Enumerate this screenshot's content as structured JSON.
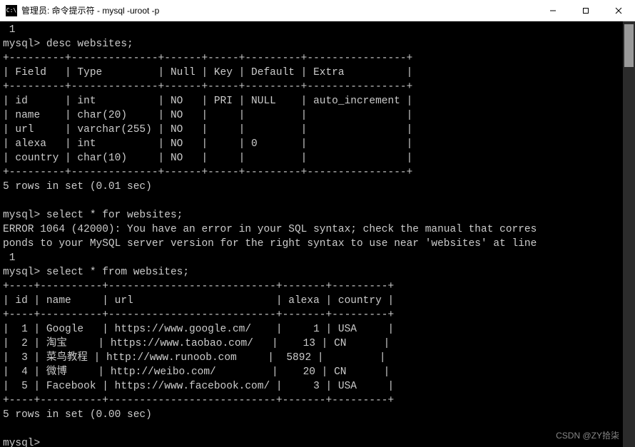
{
  "window": {
    "icon_label": "C:\\",
    "title": "管理员: 命令提示符 - mysql  -uroot -p",
    "buttons": {
      "min": "—",
      "max": "□",
      "close": "✕"
    }
  },
  "term": {
    "lines": [
      " 1",
      "mysql> desc websites;",
      "+---------+--------------+------+-----+---------+----------------+",
      "| Field   | Type         | Null | Key | Default | Extra          |",
      "+---------+--------------+------+-----+---------+----------------+",
      "| id      | int          | NO   | PRI | NULL    | auto_increment |",
      "| name    | char(20)     | NO   |     |         |                |",
      "| url     | varchar(255) | NO   |     |         |                |",
      "| alexa   | int          | NO   |     | 0       |                |",
      "| country | char(10)     | NO   |     |         |                |",
      "+---------+--------------+------+-----+---------+----------------+",
      "5 rows in set (0.01 sec)",
      "",
      "mysql> select * for websites;",
      "ERROR 1064 (42000): You have an error in your SQL syntax; check the manual that corres",
      "ponds to your MySQL server version for the right syntax to use near 'websites' at line",
      " 1",
      "mysql> select * from websites;",
      "+----+----------+---------------------------+-------+---------+",
      "| id | name     | url                       | alexa | country |",
      "+----+----------+---------------------------+-------+---------+",
      "|  1 | Google   | https://www.google.cm/    |     1 | USA     |",
      "|  2 | 淘宝     | https://www.taobao.com/   |    13 | CN      |",
      "|  3 | 菜鸟教程 | http://www.runoob.com     |  5892 |         |",
      "|  4 | 微博     | http://weibo.com/         |    20 | CN      |",
      "|  5 | Facebook | https://www.facebook.com/ |     3 | USA     |",
      "+----+----------+---------------------------+-------+---------+",
      "5 rows in set (0.00 sec)",
      "",
      "mysql>"
    ]
  },
  "chart_data": {
    "type": "table",
    "tables": [
      {
        "title": "desc websites",
        "columns": [
          "Field",
          "Type",
          "Null",
          "Key",
          "Default",
          "Extra"
        ],
        "rows": [
          [
            "id",
            "int",
            "NO",
            "PRI",
            "NULL",
            "auto_increment"
          ],
          [
            "name",
            "char(20)",
            "NO",
            "",
            "",
            ""
          ],
          [
            "url",
            "varchar(255)",
            "NO",
            "",
            "",
            ""
          ],
          [
            "alexa",
            "int",
            "NO",
            "",
            "0",
            ""
          ],
          [
            "country",
            "char(10)",
            "NO",
            "",
            "",
            ""
          ]
        ],
        "footer": "5 rows in set (0.01 sec)"
      },
      {
        "title": "select * from websites",
        "columns": [
          "id",
          "name",
          "url",
          "alexa",
          "country"
        ],
        "rows": [
          [
            1,
            "Google",
            "https://www.google.cm/",
            1,
            "USA"
          ],
          [
            2,
            "淘宝",
            "https://www.taobao.com/",
            13,
            "CN"
          ],
          [
            3,
            "菜鸟教程",
            "http://www.runoob.com",
            5892,
            ""
          ],
          [
            4,
            "微博",
            "http://weibo.com/",
            20,
            "CN"
          ],
          [
            5,
            "Facebook",
            "https://www.facebook.com/",
            3,
            "USA"
          ]
        ],
        "footer": "5 rows in set (0.00 sec)"
      }
    ],
    "error": "ERROR 1064 (42000): You have an error in your SQL syntax; check the manual that corresponds to your MySQL server version for the right syntax to use near 'websites' at line 1"
  },
  "watermark": "CSDN @ZY拾柒"
}
